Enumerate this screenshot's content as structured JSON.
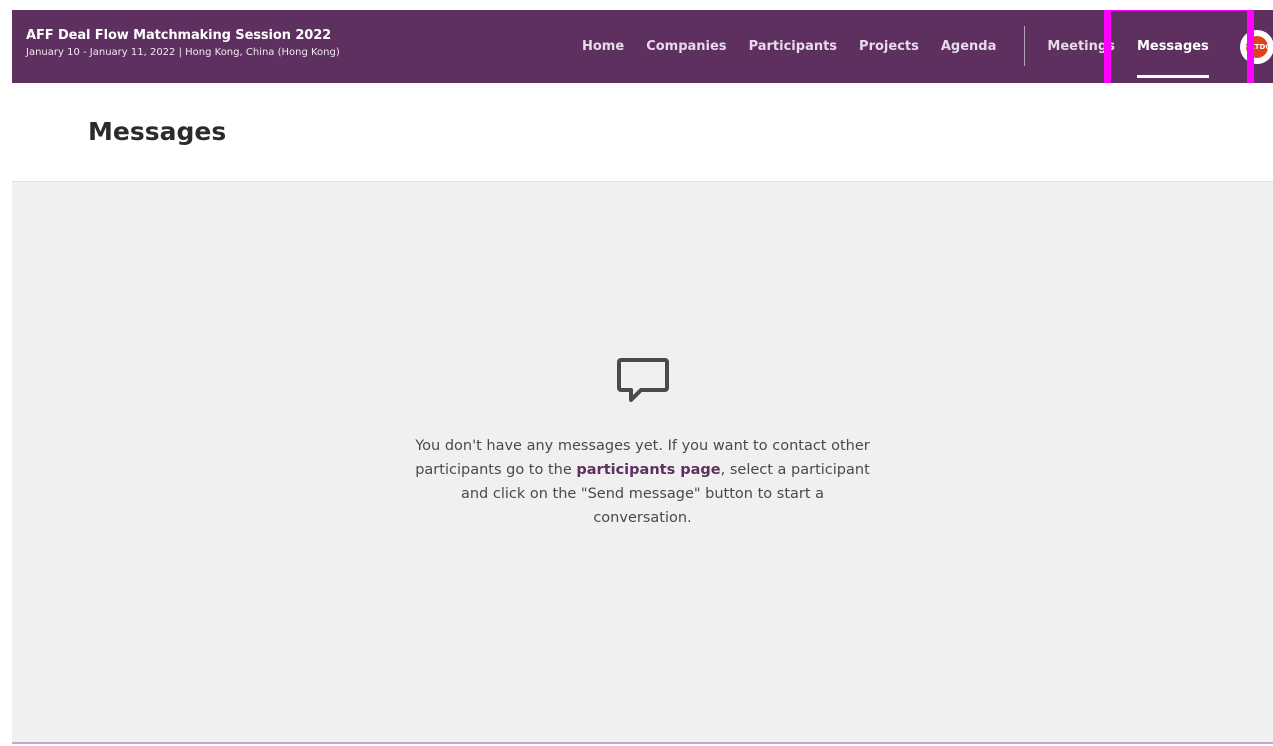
{
  "header": {
    "title": "AFF Deal Flow Matchmaking Session 2022",
    "subtitle": "January 10 - January 11, 2022 | Hong Kong, China (Hong Kong)"
  },
  "nav": {
    "items": [
      {
        "label": "Home"
      },
      {
        "label": "Companies"
      },
      {
        "label": "Participants"
      },
      {
        "label": "Projects"
      },
      {
        "label": "Agenda"
      },
      {
        "label": "Meetings"
      },
      {
        "label": "Messages",
        "active": true
      }
    ]
  },
  "avatar": {
    "logo_text": "HKTDC"
  },
  "page": {
    "title": "Messages"
  },
  "empty_state": {
    "icon": "chat-bubble-icon",
    "text_before": "You don't have any messages yet. If you want to contact other participants go to the ",
    "link_text": "participants page",
    "text_after": ", select a participant and click on the \"Send message\" button to start a conversation."
  },
  "colors": {
    "header_bg": "#5e3060",
    "content_bg": "#f0f0f0",
    "accent": "#5e3060",
    "highlight": "#ff00ff"
  }
}
